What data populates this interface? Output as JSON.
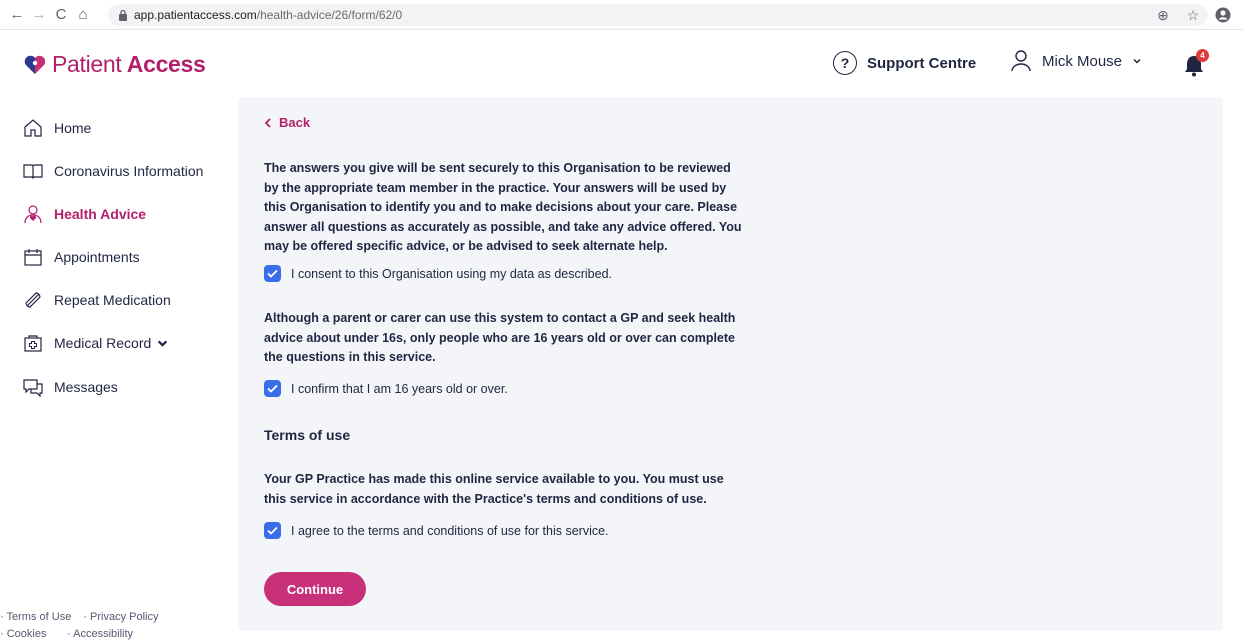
{
  "browser": {
    "host": "app.patientaccess.com",
    "path": "/health-advice/26/form/62/0"
  },
  "header": {
    "logo_main": "Patient",
    "logo_sub": "Access",
    "support_label": "Support Centre",
    "user_name": "Mick Mouse",
    "notification_count": "4"
  },
  "sidebar": {
    "items": [
      {
        "label": "Home"
      },
      {
        "label": "Coronavirus Information"
      },
      {
        "label": "Health Advice"
      },
      {
        "label": "Appointments"
      },
      {
        "label": "Repeat Medication"
      },
      {
        "label": "Medical Record"
      },
      {
        "label": "Messages"
      }
    ],
    "footer": {
      "terms": "· Terms of Use",
      "privacy": "· Privacy Policy",
      "cookies": "· Cookies",
      "accessibility": "· Accessibility"
    }
  },
  "main": {
    "back_label": "Back",
    "intro_text": "The answers you give will be sent securely to this Organisation to be reviewed by the appropriate team member in the practice. Your answers will be used by this Organisation to identify you and to make decisions about your care. Please answer all questions as accurately as possible, and take any advice offered. You may be offered specific advice, or be advised to seek alternate help.",
    "consent_label": "I consent to this Organisation using my data as described.",
    "age_text": "Although a parent or carer can use this system to contact a GP and seek health advice about under 16s, only people who are 16 years old or over can complete the questions in this service.",
    "age_label": "I confirm that I am 16 years old or over.",
    "terms_title": "Terms of use",
    "terms_text": "Your GP Practice has made this online service available to you. You must use this service in accordance with the Practice's terms and conditions of use.",
    "terms_label": "I agree to the terms and conditions of use for this service.",
    "continue_label": "Continue"
  },
  "colors": {
    "brand": "#b31f6b",
    "button": "#c8307a",
    "checkbox": "#3a6ee8",
    "panel": "#f4f5f8"
  }
}
